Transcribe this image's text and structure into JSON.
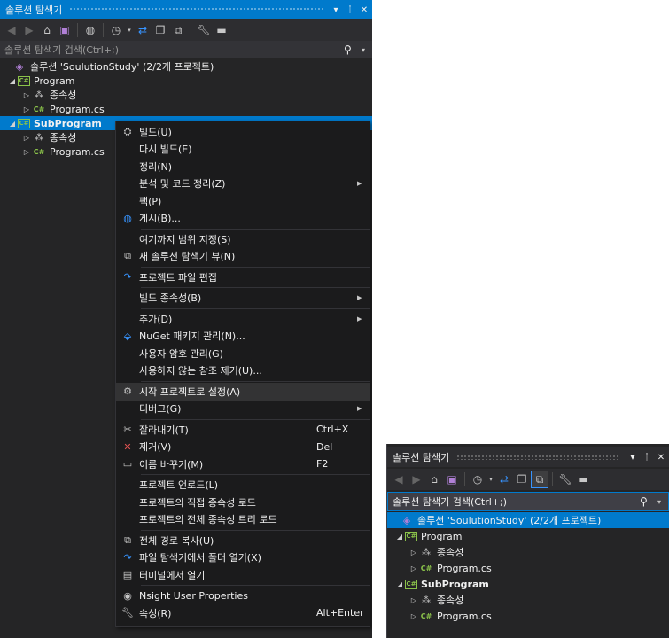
{
  "panel1": {
    "title": "솔루션 탐색기",
    "title_buttons": [
      "▾",
      "ᛙ",
      "✕"
    ],
    "search_placeholder": "솔루션 탐색기 검색(Ctrl+;)",
    "tree": {
      "solution": "솔루션 'SoulutionStudy' (2/2개 프로젝트)",
      "program": "Program",
      "program_deps": "종속성",
      "program_cs": "Program.cs",
      "subprogram": "SubProgram",
      "sub_deps": "종속성",
      "sub_cs": "Program.cs"
    }
  },
  "context_menu": {
    "items": [
      {
        "label": "빌드(U)"
      },
      {
        "label": "다시 빌드(E)"
      },
      {
        "label": "정리(N)"
      },
      {
        "label": "분석 및 코드 정리(Z)"
      },
      {
        "label": "팩(P)"
      },
      {
        "label": "게시(B)..."
      },
      {
        "label": "여기까지 범위 지정(S)"
      },
      {
        "label": "새 솔루션 탐색기 뷰(N)"
      },
      {
        "label": "프로젝트 파일 편집"
      },
      {
        "label": "빌드 종속성(B)"
      },
      {
        "label": "추가(D)"
      },
      {
        "label": "NuGet 패키지 관리(N)..."
      },
      {
        "label": "사용자 암호 관리(G)"
      },
      {
        "label": "사용하지 않는 참조 제거(U)..."
      },
      {
        "label": "시작 프로젝트로 설정(A)"
      },
      {
        "label": "디버그(G)"
      },
      {
        "label": "잘라내기(T)",
        "shortcut": "Ctrl+X"
      },
      {
        "label": "제거(V)",
        "shortcut": "Del"
      },
      {
        "label": "이름 바꾸기(M)",
        "shortcut": "F2"
      },
      {
        "label": "프로젝트 언로드(L)"
      },
      {
        "label": "프로젝트의 직접 종속성 로드"
      },
      {
        "label": "프로젝트의 전체 종속성 트리 로드"
      },
      {
        "label": "전체 경로 복사(U)"
      },
      {
        "label": "파일 탐색기에서 폴더 열기(X)"
      },
      {
        "label": "터미널에서 열기"
      },
      {
        "label": "Nsight User Properties"
      },
      {
        "label": "속성(R)",
        "shortcut": "Alt+Enter"
      }
    ]
  },
  "panel2": {
    "title": "솔루션 탐색기",
    "search_placeholder": "솔루션 탐색기 검색(Ctrl+;)",
    "tree": {
      "solution": "솔루션 'SoulutionStudy' (2/2개 프로젝트)",
      "program": "Program",
      "program_deps": "종속성",
      "program_cs": "Program.cs",
      "subprogram": "SubProgram",
      "sub_deps": "종속성",
      "sub_cs": "Program.cs"
    }
  },
  "colors": {
    "accent": "#007acc",
    "panel_bg": "#252526",
    "menu_bg": "#1b1b1c",
    "csharp_green": "#8bc34a",
    "solution_purple": "#b180d7"
  },
  "icons": {
    "back": "arrow-left-icon",
    "forward": "arrow-right-icon",
    "home": "home-icon",
    "switch_views": "switch-views-icon",
    "pending_changes": "globe-icon",
    "history": "clock-icon",
    "sync": "sync-icon",
    "collapse_all": "collapse-all-icon",
    "show_all_files": "show-all-files-icon",
    "properties": "wrench-icon",
    "preview": "minus-icon"
  }
}
